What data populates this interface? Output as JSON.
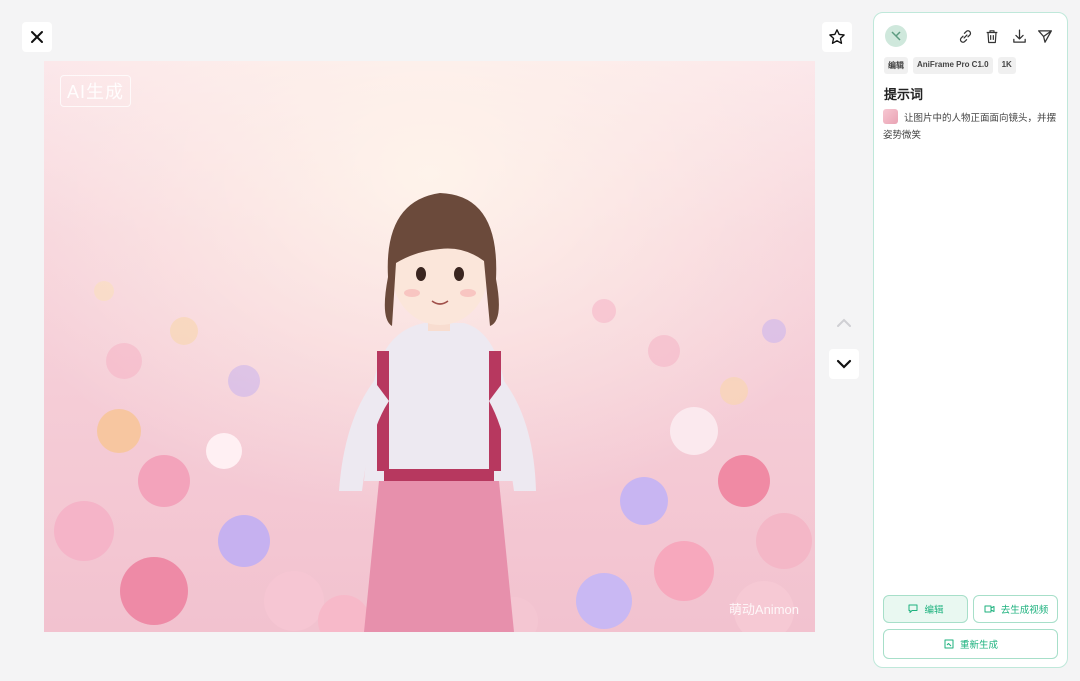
{
  "image": {
    "ai_badge": "AI生成",
    "watermark": "萌动Animon",
    "alt_subject": "anime girl in pink cosmos flower field"
  },
  "controls": {
    "close_icon": "close-icon",
    "favorite_icon": "star-icon",
    "prev_icon": "chevron-up-icon",
    "next_icon": "chevron-down-icon"
  },
  "panel": {
    "tools": [
      "link-icon",
      "trash-icon",
      "download-icon",
      "send-icon"
    ],
    "tags": [
      "编辑",
      "AniFrame Pro C1.0",
      "1K"
    ],
    "prompt_title": "提示词",
    "prompt_text": "让图片中的人物正面面向镜头，并摆姿势微笑",
    "buttons": {
      "edit": "编辑",
      "make_video": "去生成视频",
      "regenerate": "重新生成"
    }
  },
  "colors": {
    "accent": "#1db27e",
    "panel_border": "#bfe8da",
    "background": "#f4f4f5"
  }
}
